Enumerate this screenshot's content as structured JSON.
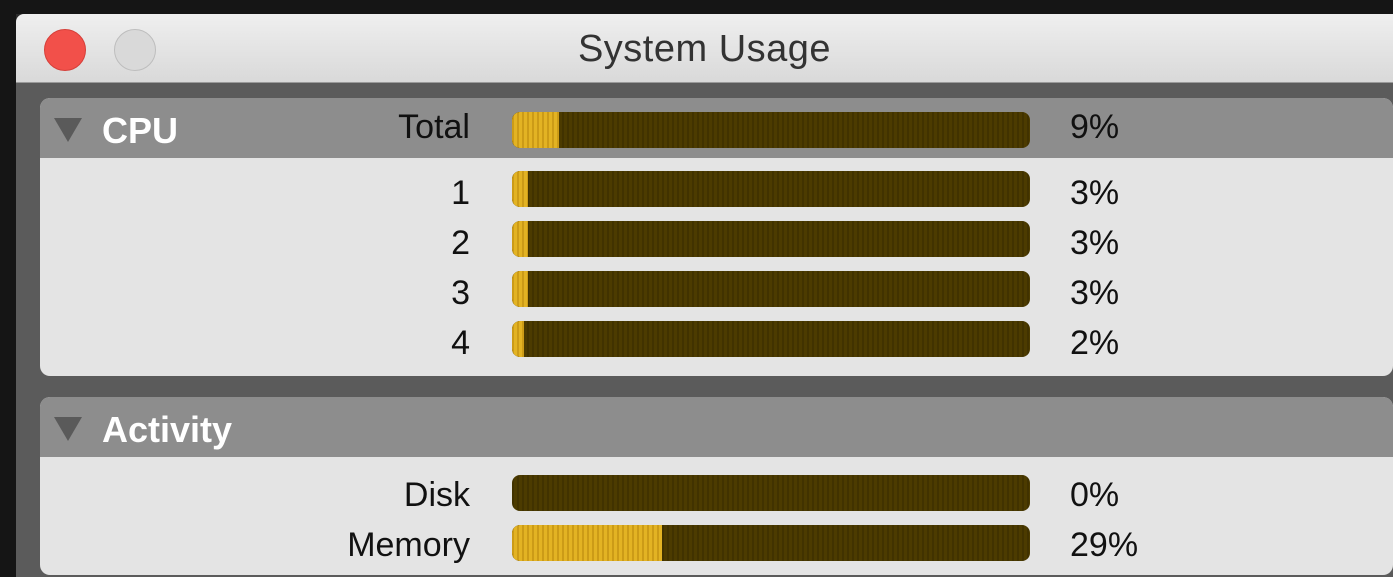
{
  "window": {
    "title": "System Usage"
  },
  "cpu": {
    "section_label": "CPU",
    "rows": [
      {
        "label": "Total",
        "percent_text": "9%",
        "value": 9
      },
      {
        "label": "1",
        "percent_text": "3%",
        "value": 3
      },
      {
        "label": "2",
        "percent_text": "3%",
        "value": 3
      },
      {
        "label": "3",
        "percent_text": "3%",
        "value": 3
      },
      {
        "label": "4",
        "percent_text": "2%",
        "value": 2
      }
    ]
  },
  "activity": {
    "section_label": "Activity",
    "rows": [
      {
        "label": "Disk",
        "percent_text": "0%",
        "value": 0
      },
      {
        "label": "Memory",
        "percent_text": "29%",
        "value": 29
      }
    ]
  },
  "colors": {
    "bar_fill": "#e3b323",
    "bar_track": "#4c3b00",
    "close_button": "#f2504a"
  }
}
